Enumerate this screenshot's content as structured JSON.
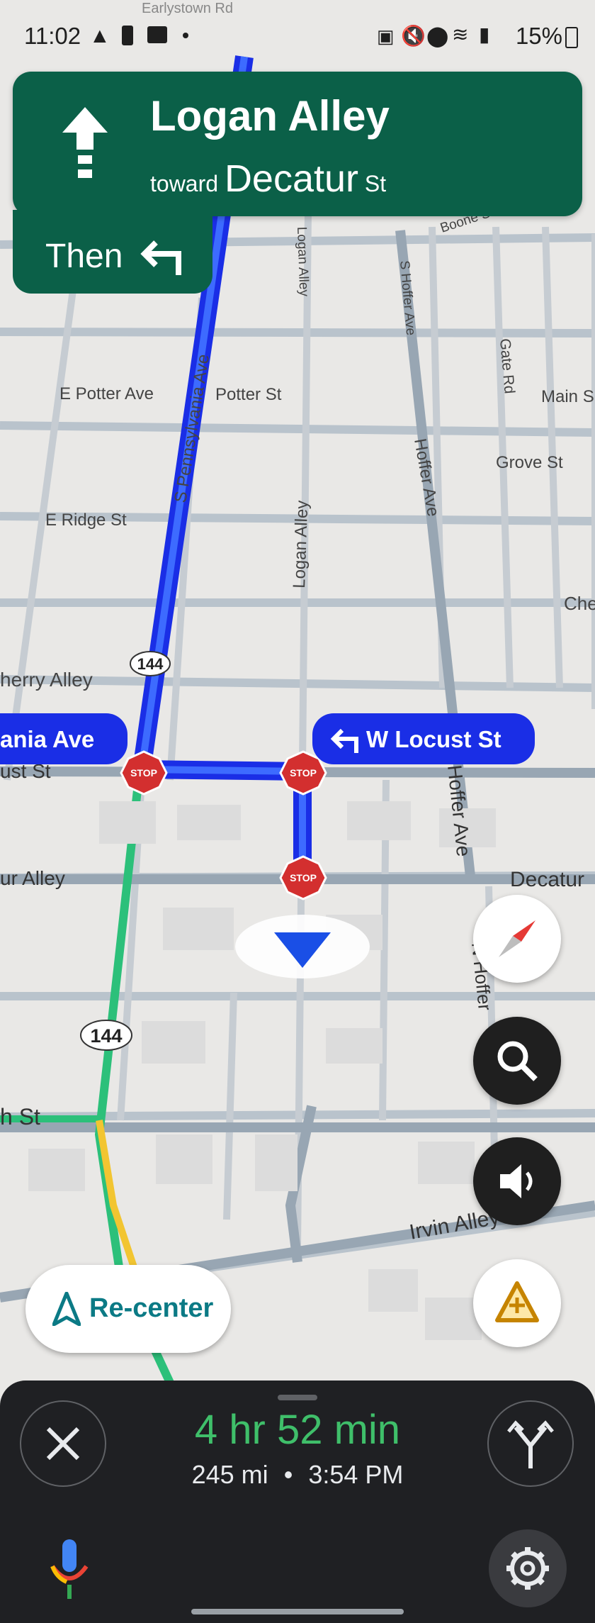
{
  "status_bar": {
    "time": "11:02",
    "battery": "15%"
  },
  "navigation": {
    "street": "Logan Alley",
    "toward_prefix": "toward",
    "toward_street": "Decatur",
    "toward_suffix": "St",
    "then_label": "Then",
    "next_turn_label": "W Locust St",
    "current_street_label": "ania Ave"
  },
  "map": {
    "labels": {
      "earlystown": "Earlystown Rd",
      "e_potter": "E Potter Ave",
      "potter": "Potter St",
      "s_pennsylvania": "S Pennsylvania Ave",
      "logan_top": "Logan Alley",
      "logan_mid": "Logan Alley",
      "s_hoffer": "S Hoffer Ave",
      "gate": "Gate Rd",
      "main": "Main S",
      "grove": "Grove St",
      "boone": "Boone St",
      "hoffer_mid": "Hoffer Ave",
      "e_ridge": "E Ridge St",
      "che": "Che",
      "cherry": "herry Alley",
      "locust_left": "ust St",
      "decatur_left": "ur Alley",
      "decatur_right": "Decatur",
      "hoffer_low": "Hoffer Ave",
      "n_hoffer": "N Hoffer",
      "h_st": "h St",
      "irvin": "Irvin Alley"
    },
    "route_shield": "144",
    "stop_sign": "STOP"
  },
  "controls": {
    "recenter_label": "Re-center",
    "compass_icon": "compass-icon",
    "search_icon": "search-icon",
    "sound_icon": "volume-icon",
    "report_icon": "report-incident-icon"
  },
  "trip": {
    "duration": "4 hr 52 min",
    "distance": "245 mi",
    "separator": "•",
    "arrival": "3:54 PM"
  },
  "colors": {
    "banner": "#0b6048",
    "route": "#1a2ee6",
    "eta": "#3fbf6a",
    "bottom_sheet": "#1f2023"
  }
}
